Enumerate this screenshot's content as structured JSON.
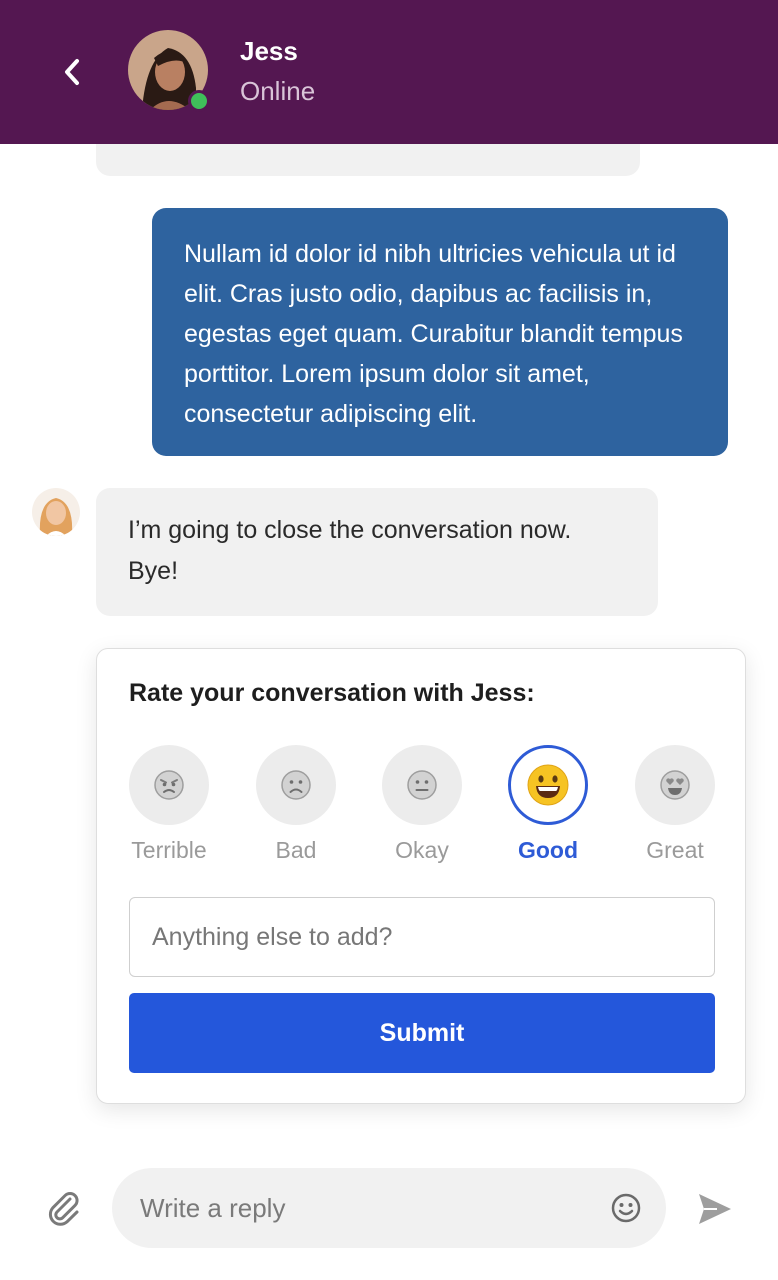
{
  "header": {
    "agent_name": "Jess",
    "agent_status": "Online",
    "status_color": "#3fbf5a",
    "background_color": "#541751"
  },
  "messages": {
    "outgoing_text": "Nullam id dolor id nibh ultricies vehicula ut id elit. Cras justo odio, dapibus ac facilisis in, egestas eget quam. Curabitur blandit tempus porttitor. Lorem ipsum dolor sit amet, consectetur adipiscing elit.",
    "incoming_text": "I’m going to close the conversation now. Bye!",
    "outgoing_color": "#2e639f"
  },
  "rating": {
    "title": "Rate your conversation with Jess:",
    "options": [
      {
        "label": "Terrible",
        "icon": "angry-face-icon",
        "selected": false
      },
      {
        "label": "Bad",
        "icon": "frowning-face-icon",
        "selected": false
      },
      {
        "label": "Okay",
        "icon": "neutral-face-icon",
        "selected": false
      },
      {
        "label": "Good",
        "icon": "grinning-face-icon",
        "selected": true
      },
      {
        "label": "Great",
        "icon": "heart-eyes-face-icon",
        "selected": false
      }
    ],
    "feedback_placeholder": "Anything else to add?",
    "feedback_value": "",
    "submit_label": "Submit",
    "accent_color": "#2457db"
  },
  "composer": {
    "placeholder": "Write a reply",
    "attach_icon": "paperclip-icon",
    "emoji_icon": "smiley-icon",
    "send_icon": "send-icon"
  }
}
